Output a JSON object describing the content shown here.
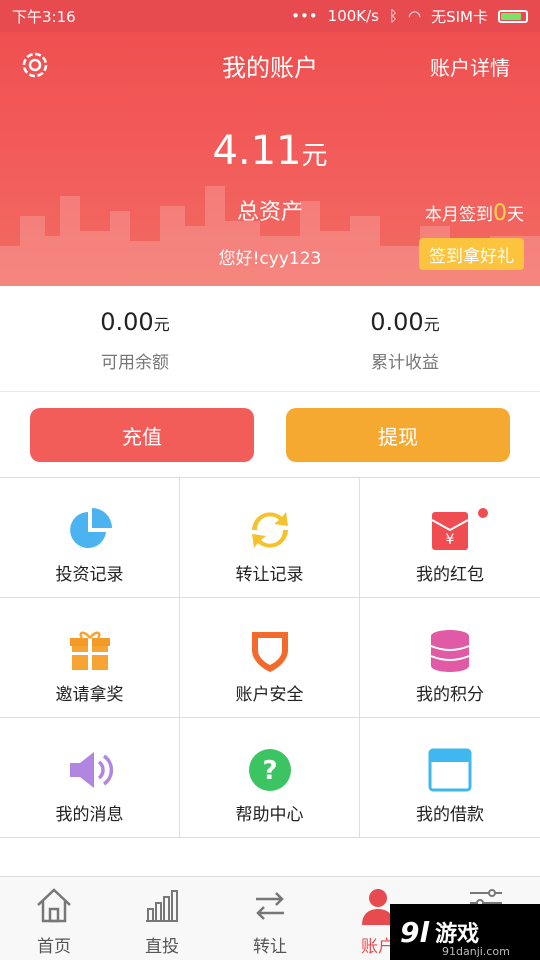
{
  "status_bar": {
    "time": "下午3:16",
    "speed": "100K/s",
    "sim": "无SIM卡"
  },
  "header": {
    "title": "我的账户",
    "detail_link": "账户详情",
    "total_value": "4.11",
    "total_unit": "元",
    "total_label": "总资产",
    "greeting": "您好!cyy123",
    "checkin_prefix": "本月签到",
    "checkin_days": "0",
    "checkin_suffix": "天",
    "checkin_button": "签到拿好礼"
  },
  "balances": [
    {
      "value": "0.00",
      "unit": "元",
      "label": "可用余额"
    },
    {
      "value": "0.00",
      "unit": "元",
      "label": "累计收益"
    }
  ],
  "actions": {
    "recharge": "充值",
    "withdraw": "提现"
  },
  "grid": [
    {
      "label": "投资记录",
      "icon": "pie-chart-icon"
    },
    {
      "label": "转让记录",
      "icon": "transfer-arrows-icon"
    },
    {
      "label": "我的红包",
      "icon": "red-envelope-icon"
    },
    {
      "label": "邀请拿奖",
      "icon": "gift-box-icon"
    },
    {
      "label": "账户安全",
      "icon": "shield-icon"
    },
    {
      "label": "我的积分",
      "icon": "database-icon"
    },
    {
      "label": "我的消息",
      "icon": "speaker-icon"
    },
    {
      "label": "帮助中心",
      "icon": "help-question-icon"
    },
    {
      "label": "我的借款",
      "icon": "window-card-icon"
    }
  ],
  "tabs": [
    {
      "label": "首页",
      "icon": "home-icon"
    },
    {
      "label": "直投",
      "icon": "bar-chart-icon"
    },
    {
      "label": "转让",
      "icon": "swap-arrows-icon"
    },
    {
      "label": "账户",
      "icon": "user-icon",
      "active": true
    },
    {
      "label": "",
      "icon": "settings-sliders-icon"
    }
  ],
  "watermark": {
    "logo": "9l",
    "text": "游戏",
    "sub": "91danji.com"
  },
  "colors": {
    "brand_red": "#e84b4f",
    "button_orange": "#f6a930",
    "checkin_yellow": "#fbc33e"
  }
}
